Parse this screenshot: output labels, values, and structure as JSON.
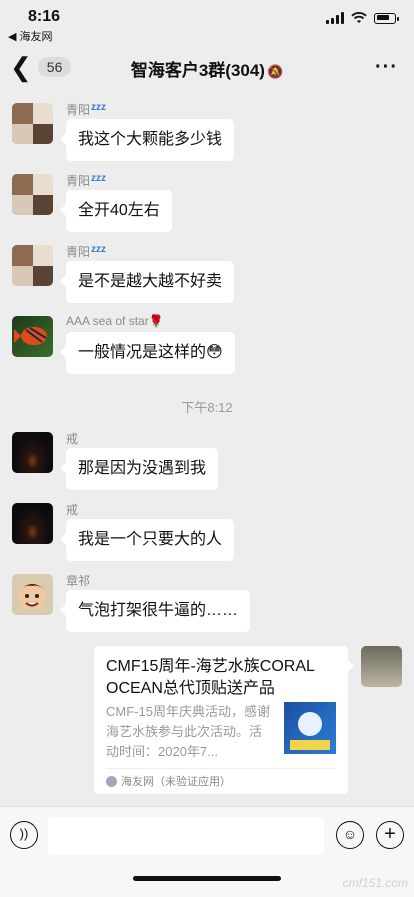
{
  "status": {
    "time": "8:16",
    "back_app": "◀ 海友网"
  },
  "nav": {
    "back_count": "56",
    "title": "智海客户3群(304)"
  },
  "messages": [
    {
      "sender": "青阳",
      "text": "我这个大颗能多少钱",
      "zz": true
    },
    {
      "sender": "青阳",
      "text": "全开40左右",
      "zz": true
    },
    {
      "sender": "青阳",
      "text": "是不是越大越不好卖",
      "zz": true
    },
    {
      "sender": "AAA sea of star🌹",
      "text": "一般情况是这样的😳"
    },
    {
      "sender": "戒",
      "text": "那是因为没遇到我"
    },
    {
      "sender": "戒",
      "text": "我是一个只要大的人"
    },
    {
      "sender": "章祁",
      "text": "气泡打架很牛逼的……"
    }
  ],
  "time_separator": "下午8:12",
  "link_card": {
    "title": "CMF15周年-海艺水族CORAL OCEAN总代顶贴送产品",
    "description": "CMF-15周年庆典活动，感谢海艺水族参与此次活动。活动时间：2020年7...",
    "source": "海友网（未验证应用）"
  },
  "watermark": "cmf151.com"
}
